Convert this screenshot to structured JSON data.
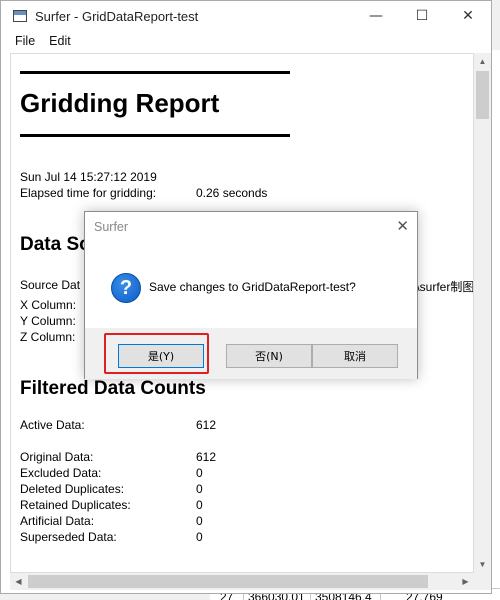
{
  "window": {
    "title": "Surfer - GridDataReport-test",
    "minimize": "—",
    "maximize": "☐",
    "close": "✕"
  },
  "menu": {
    "file": "File",
    "edit": "Edit"
  },
  "report": {
    "title": "Gridding Report",
    "date": "Sun Jul 14 15:27:12 2019",
    "elapsed_label": "Elapsed time for gridding:",
    "elapsed_value": "0.26 seconds",
    "data_source_heading": "Data So",
    "source_label": "Source Dat",
    "source_path_tail": "t\\surfer制图",
    "x_column": "X Column:",
    "y_column": "Y Column:",
    "z_column": "Z Column:",
    "filtered_heading": "Filtered Data Counts",
    "counts": [
      {
        "label": "Active Data:",
        "value": "612"
      },
      {
        "label": "Original Data:",
        "value": "612"
      },
      {
        "label": "Excluded Data:",
        "value": "0"
      },
      {
        "label": "Deleted Duplicates:",
        "value": "0"
      },
      {
        "label": "Retained Duplicates:",
        "value": "0"
      },
      {
        "label": "Artificial Data:",
        "value": "0"
      },
      {
        "label": "Superseded Data:",
        "value": "0"
      }
    ]
  },
  "background_grid": {
    "row": "27",
    "x": "366030.01",
    "y": "3508146.4",
    "z": "27.769"
  },
  "dialog": {
    "title": "Surfer",
    "close": "✕",
    "icon": "?",
    "message": "Save changes to GridDataReport-test?",
    "yes": "是(Y)",
    "no": "否(N)",
    "cancel": "取消"
  },
  "colors": {
    "highlight": "#e02020",
    "accent": "#0078d7"
  }
}
